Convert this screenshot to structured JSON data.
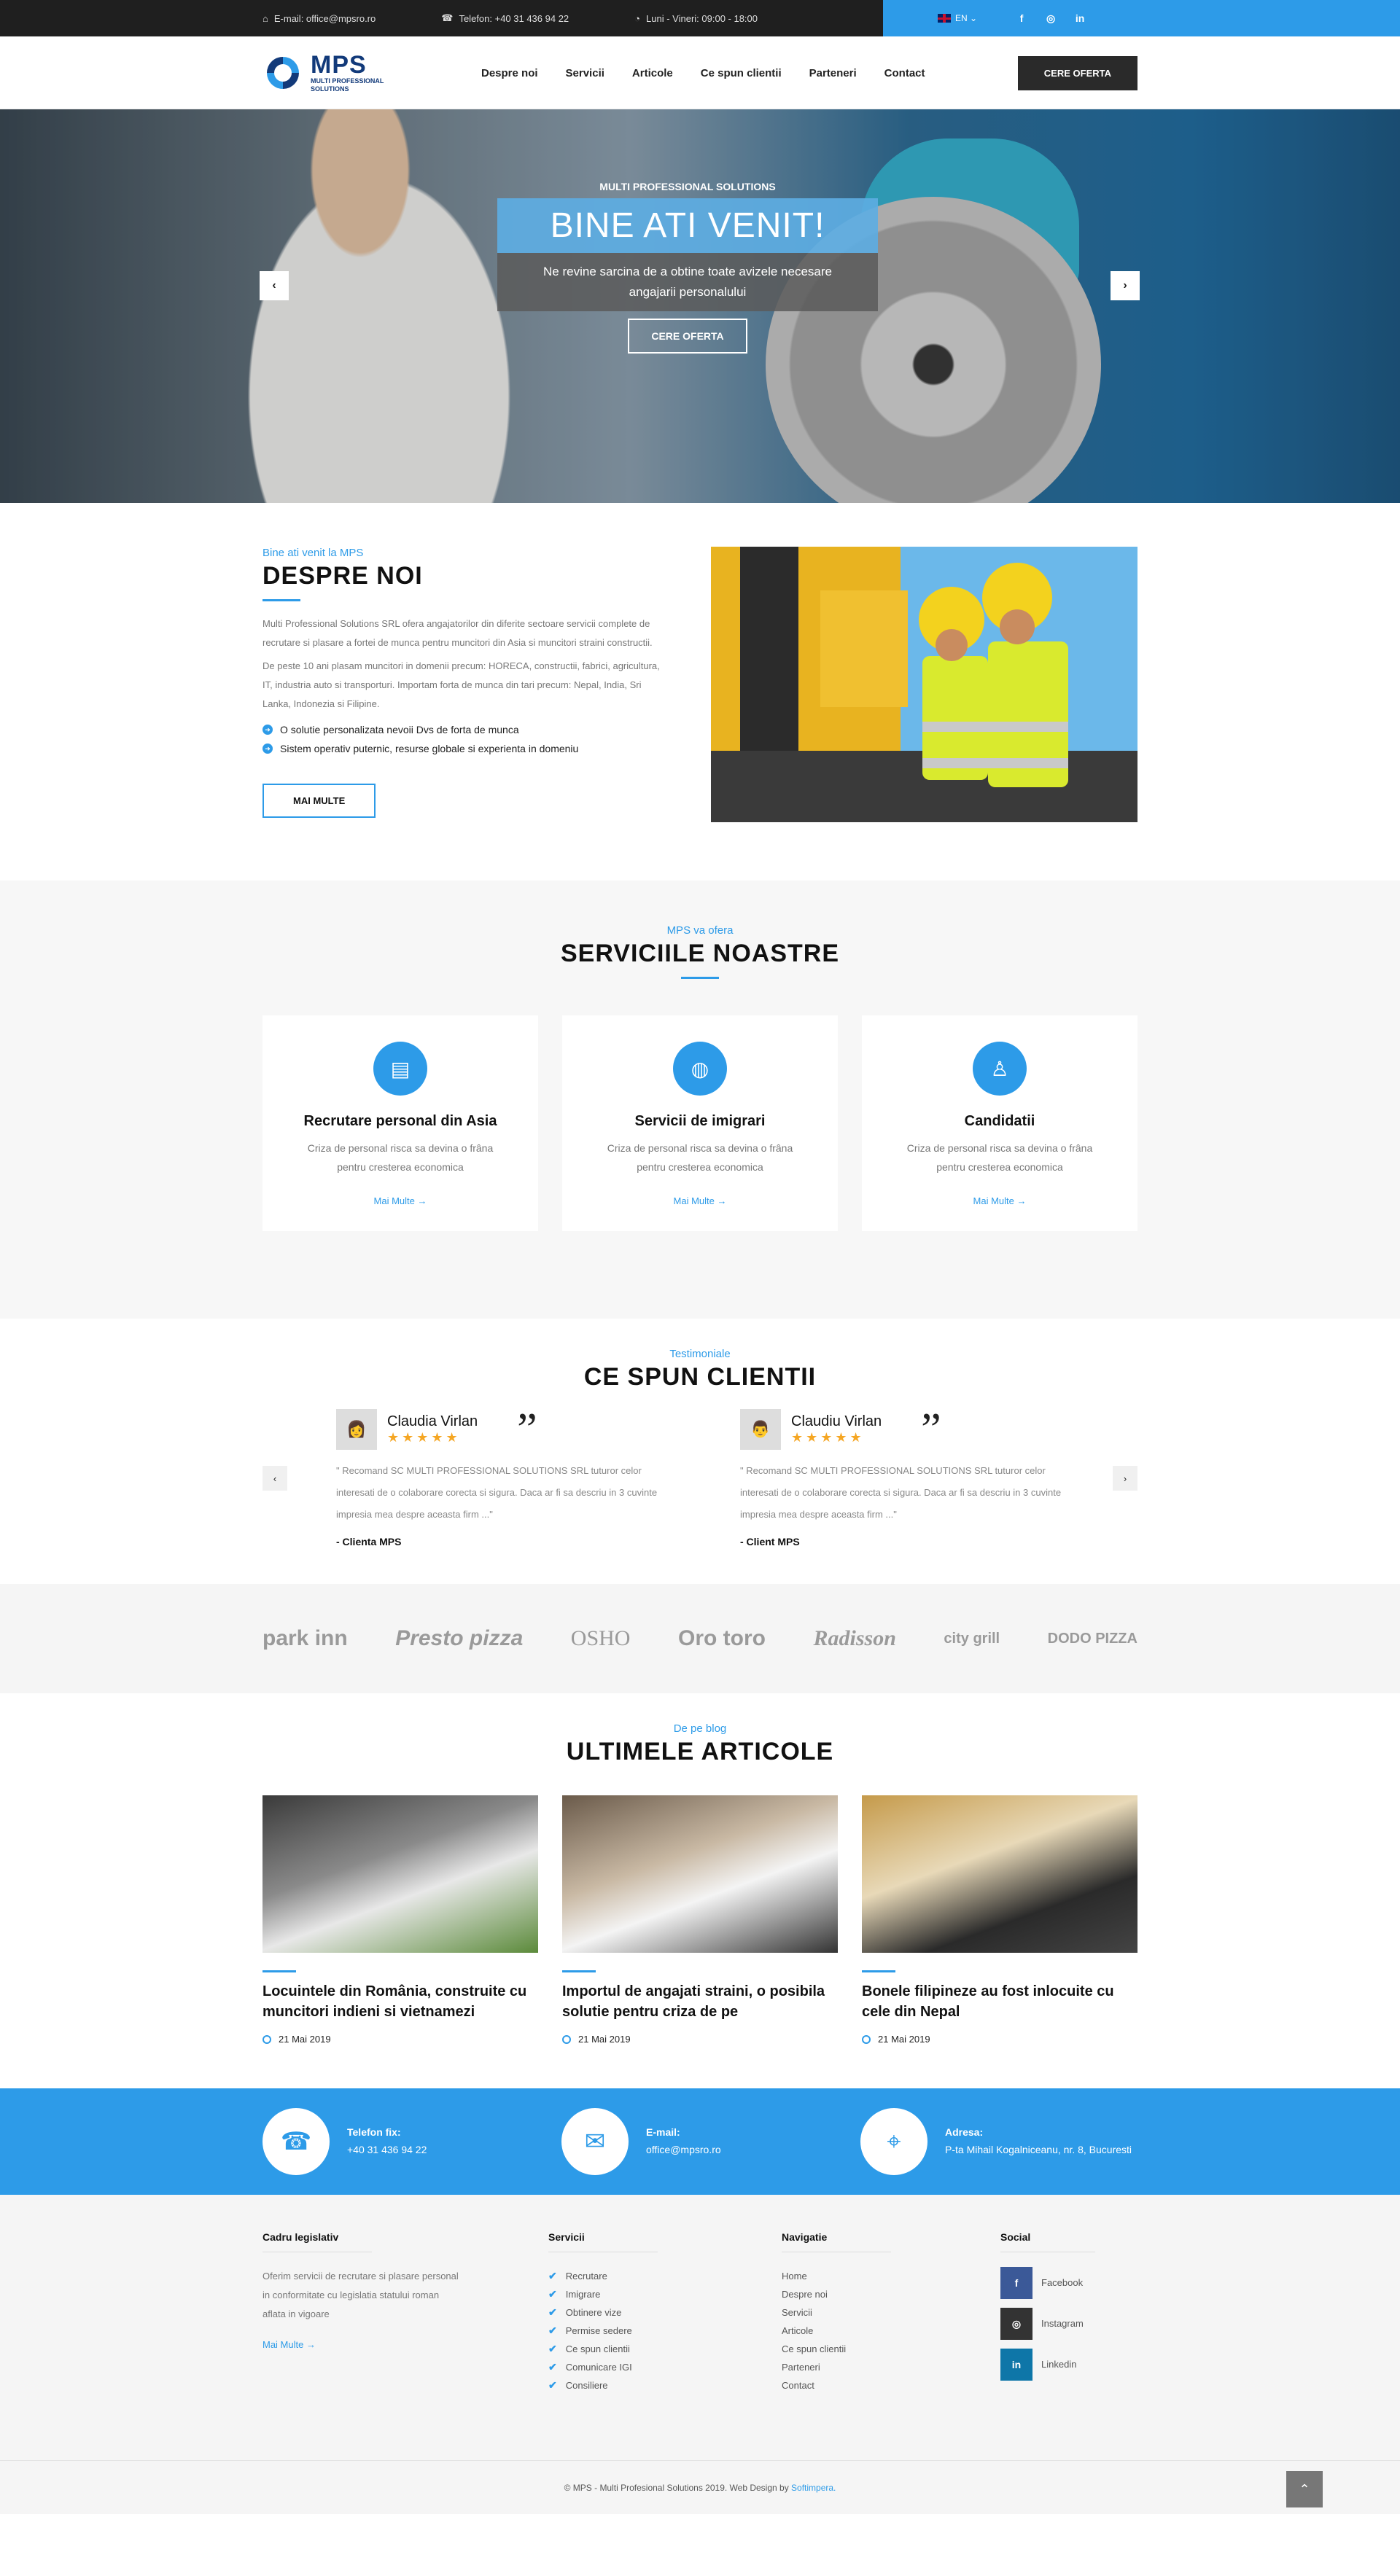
{
  "topbar": {
    "email": "E-mail: office@mpsro.ro",
    "phone": "Telefon: +40 31 436 94 22",
    "hours": "Luni - Vineri: 09:00 - 18:00",
    "lang": "EN",
    "social": [
      "f",
      "◎",
      "in"
    ]
  },
  "header": {
    "logo_main": "MPS",
    "logo_sub1": "MULTI PROFESSIONAL",
    "logo_sub2": "SOLUTIONS",
    "nav": [
      "Despre noi",
      "Servicii",
      "Articole",
      "Ce spun clientii",
      "Parteneri",
      "Contact"
    ],
    "cta": "CERE OFERTA"
  },
  "hero": {
    "kicker": "MULTI PROFESSIONAL SOLUTIONS",
    "title": "BINE ATI VENIT!",
    "subtitle": "Ne revine sarcina de a obtine toate avizele necesare angajarii personalului",
    "button": "CERE OFERTA"
  },
  "about": {
    "kicker": "Bine ati venit la MPS",
    "title_light": "DESPRE",
    "title_bold": "NOI",
    "p1": "Multi Professional Solutions SRL ofera angajatorilor din diferite sectoare servicii complete de recrutare si plasare a fortei de munca pentru muncitori din Asia si muncitori straini constructii.",
    "p2": "De peste 10 ani plasam muncitori in domenii precum: HORECA, constructii, fabrici, agricultura, IT, industria auto si transporturi. Importam forta de munca din tari precum: Nepal, India, Sri Lanka, Indonezia si Filipine.",
    "check1": "O solutie personalizata nevoii Dvs de forta de munca",
    "check2": "Sistem operativ puternic, resurse globale si experienta in domeniu",
    "button": "MAI MULTE"
  },
  "services": {
    "kicker": "MPS va ofera",
    "title_light": "SERVICIILE",
    "title_bold": "NOASTRE",
    "items": [
      {
        "title": "Recrutare personal din Asia",
        "text": "Criza de personal risca sa devina o frâna pentru cresterea economica",
        "link": "Mai Multe →"
      },
      {
        "title": "Servicii de imigrari",
        "text": "Criza de personal risca sa devina o frâna pentru cresterea economica",
        "link": "Mai Multe →"
      },
      {
        "title": "Candidatii",
        "text": "Criza de personal risca sa devina o frâna pentru cresterea economica",
        "link": "Mai Multe →"
      }
    ]
  },
  "testimonials": {
    "kicker": "Testimoniale",
    "title_light": "CE SPUN",
    "title_bold": "CLIENTII",
    "items": [
      {
        "name": "Claudia Virlan",
        "stars": "★★★★★",
        "text": "\" Recomand SC MULTI PROFESSIONAL SOLUTIONS SRL tuturor celor interesati de o colaborare corecta si sigura. Daca ar fi sa descriu in 3 cuvinte impresia mea despre aceasta firm ...\"",
        "author": "- Clienta MPS"
      },
      {
        "name": "Claudiu Virlan",
        "stars": "★★★★★",
        "text": "\" Recomand SC MULTI PROFESSIONAL SOLUTIONS SRL tuturor celor interesati de o colaborare corecta si sigura. Daca ar fi sa descriu in 3 cuvinte impresia mea despre aceasta firm ...\"",
        "author": "- Client MPS"
      }
    ]
  },
  "clients": [
    "park inn",
    "Presto pizza",
    "OSHO",
    "Oro toro",
    "Radisson",
    "city grill",
    "DODO PIZZA"
  ],
  "blog": {
    "kicker": "De pe blog",
    "title_light": "ULTIMELE",
    "title_bold": "ARTICOLE",
    "posts": [
      {
        "title": "Locuintele din România, construite cu muncitori indieni si vietnamezi",
        "date": "21 Mai 2019"
      },
      {
        "title": "Importul de angajati straini, o posibila solutie pentru criza de pe",
        "date": "21 Mai 2019"
      },
      {
        "title": "Bonele filipineze au fost inlocuite cu cele din Nepal",
        "date": "21 Mai 2019"
      }
    ]
  },
  "contact": {
    "phone_label": "Telefon fix:",
    "phone": "+40 31 436 94 22",
    "email_label": "E-mail:",
    "email": "office@mpsro.ro",
    "address_label": "Adresa:",
    "address": "P-ta Mihail Kogalniceanu, nr. 8, Bucuresti"
  },
  "footer": {
    "col1_title": "Cadru legislativ",
    "col1_text": "Oferim servicii de recrutare si plasare personal in conformitate cu legislatia statului roman aflata in vigoare",
    "col1_link": "Mai Multe →",
    "col2_title": "Servicii",
    "col2_items": [
      "Recrutare",
      "Imigrare",
      "Obtinere vize",
      "Permise sedere",
      "Ce spun clientii",
      "Comunicare IGI",
      "Consiliere"
    ],
    "col3_title": "Navigatie",
    "col3_items": [
      "Home",
      "Despre noi",
      "Servicii",
      "Articole",
      "Ce spun clientii",
      "Parteneri",
      "Contact"
    ],
    "col4_title": "Social",
    "col4_items": [
      "Facebook",
      "Instagram",
      "Linkedin"
    ],
    "copyright": "© MPS - Multi Profesional Solutions 2019. Web Design by ",
    "designer": "Softimpera."
  }
}
